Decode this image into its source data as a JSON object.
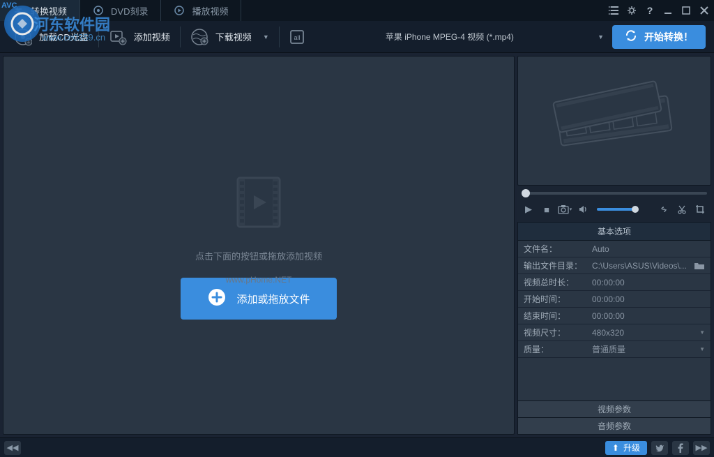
{
  "tabs": {
    "convert": "转换视频",
    "dvd": "DVD刻录",
    "play": "播放视频"
  },
  "toolbar": {
    "load_cd": "加载CD光盘",
    "add_video": "添加视频",
    "download_video": "下载视频",
    "profile": "苹果 iPhone MPEG-4 视频 (*.mp4)",
    "start": "开始转换！"
  },
  "main": {
    "hint": "点击下面的按钮或拖放添加视频",
    "add_btn": "添加或拖放文件",
    "watermark": "www.pHome.NET"
  },
  "options": {
    "header_basic": "基本选项",
    "rows": [
      {
        "label": "文件名：",
        "value": "Auto",
        "type": "text"
      },
      {
        "label": "输出文件目录：",
        "value": "C:\\Users\\ASUS\\Videos\\...",
        "type": "browse"
      },
      {
        "label": "视频总时长：",
        "value": "00:00:00",
        "type": "text"
      },
      {
        "label": "开始时间：",
        "value": "00:00:00",
        "type": "text"
      },
      {
        "label": "结束时间：",
        "value": "00:00:00",
        "type": "text"
      },
      {
        "label": "视频尺寸：",
        "value": "480x320",
        "type": "select"
      },
      {
        "label": "质量：",
        "value": "普通质量",
        "type": "select"
      }
    ],
    "header_video": "视频参数",
    "header_audio": "音频参数"
  },
  "bottom": {
    "upgrade": "升级"
  },
  "overlay": {
    "avc": "AVC",
    "brand": "河东软件园",
    "url": "www.ce0359.cn"
  }
}
